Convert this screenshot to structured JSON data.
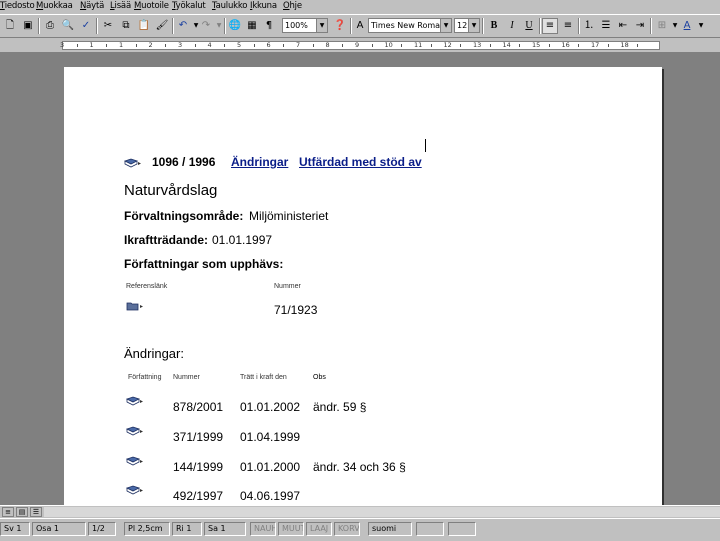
{
  "menu": [
    "Tiedosto",
    "Muokkaa",
    "Näytä",
    "Lisää",
    "Muotoile",
    "Työkalut",
    "Taulukko",
    "Ikkuna",
    "Ohje"
  ],
  "toolbar": {
    "zoom": "100%",
    "font": "Times New Roman",
    "size": "12",
    "bold": "B",
    "italic": "I",
    "underline": "U"
  },
  "ruler": {
    "numbers": [
      "3",
      "1",
      "1",
      "2",
      "3",
      "4",
      "5",
      "6",
      "7",
      "8",
      "9",
      "10",
      "11",
      "12",
      "13",
      "14",
      "15",
      "16",
      "17",
      "18"
    ]
  },
  "document": {
    "statute_number": "1096 / 1996",
    "link_changes": "Ändringar",
    "link_issued": "Utfärdad med stöd av",
    "title": "Naturvårdslag",
    "admin_label": "Förvaltningsområde:",
    "admin_value": "Miljöministeriet",
    "effective_label": "Ikraftträdande:",
    "effective_value": "01.01.1997",
    "repealed_label": "Författningar som upphävs:",
    "repealed_col_ref": "Referenslänk",
    "repealed_col_num": "Nummer",
    "repealed_row_num": "71/1923",
    "changes_heading": "Ändringar:",
    "changes_col_1": "Författning",
    "changes_col_2": "Nummer",
    "changes_col_3": "Trätt i kraft den",
    "changes_col_4": "Obs",
    "changes": [
      {
        "num": "878/2001",
        "date": "01.01.2002",
        "note": "ändr. 59 §"
      },
      {
        "num": "371/1999",
        "date": "01.04.1999",
        "note": ""
      },
      {
        "num": "144/1999",
        "date": "01.01.2000",
        "note": "ändr. 34 och 36 §"
      },
      {
        "num": "492/1997",
        "date": "04.06.1997",
        "note": ""
      }
    ]
  },
  "status": {
    "page": "Sv 1",
    "section": "Osa 1",
    "pages": "1/2",
    "position": "Pl 2,5cm",
    "line": "Ri 1",
    "column": "Sa 1",
    "rec": "NAUH",
    "trk": "MUUT",
    "ext": "LAAJ",
    "ovr": "KORV",
    "lang": "suomi"
  }
}
